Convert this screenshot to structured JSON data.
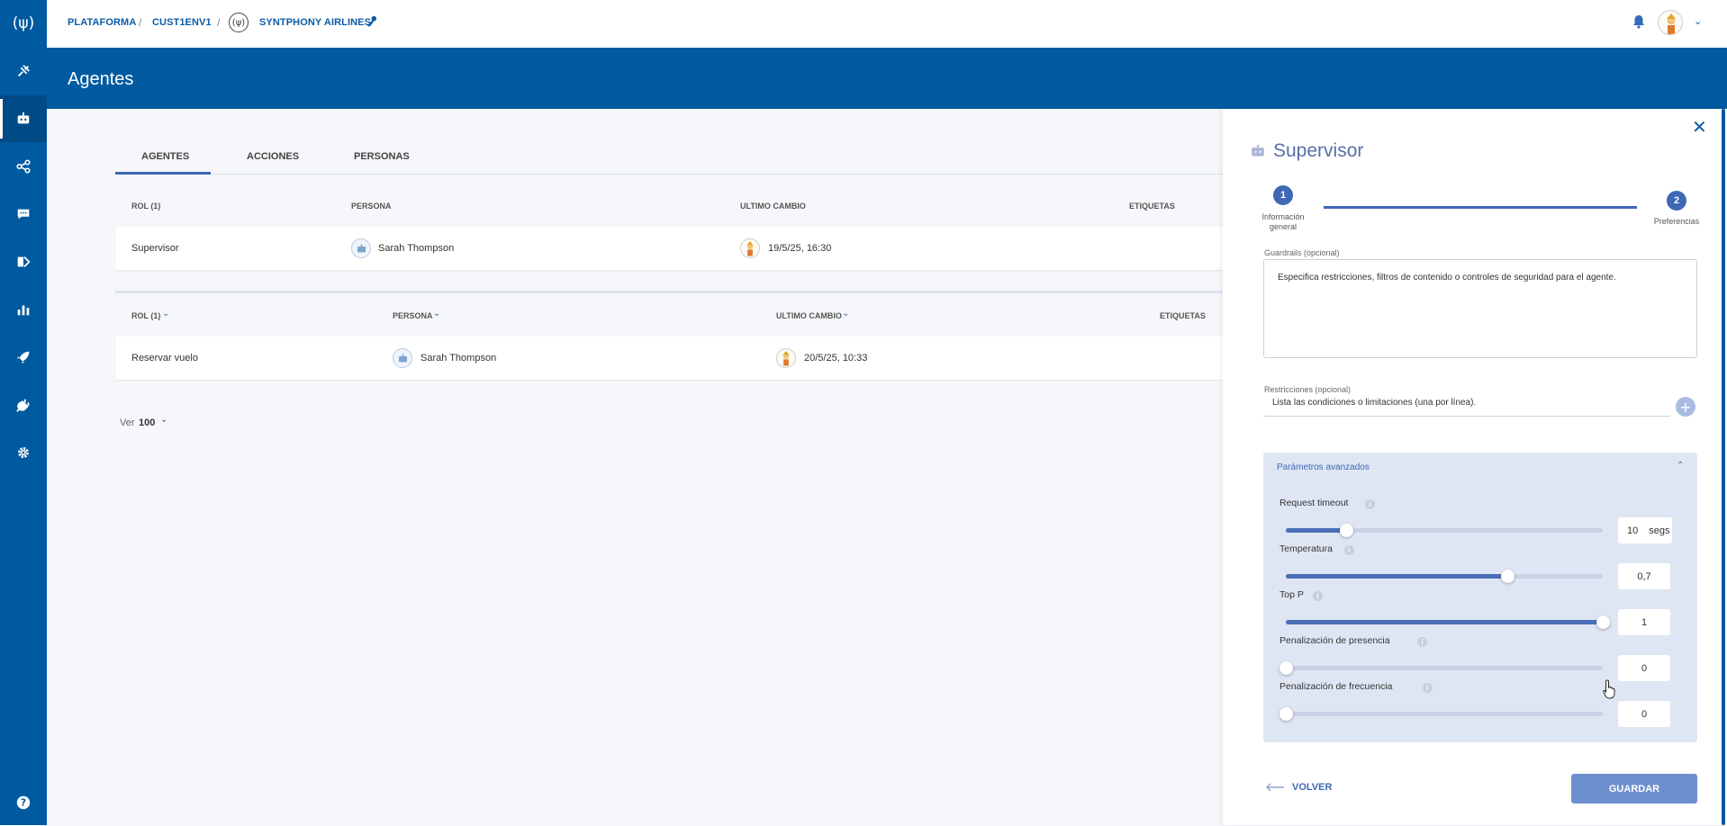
{
  "sidebar": {
    "logo_icon": "synthphony-logo-icon",
    "items": [
      "satellite-icon",
      "bot-icon",
      "flow-icon",
      "chat-icon",
      "integration-icon",
      "analytics-icon",
      "rocket-icon",
      "plug-icon",
      "gear-icon"
    ],
    "help_icon": "help-icon",
    "active_index": 1
  },
  "breadcrumb": {
    "item1": "PLATAFORMA",
    "item2": "CUST1ENV1",
    "item3": "SYNTPHONY AIRLINES",
    "sep": "/"
  },
  "page": {
    "title": "Agentes"
  },
  "tabs": [
    "AGENTES",
    "ACCIONES",
    "PERSONAS"
  ],
  "table1": {
    "headers": [
      "ROL (1)",
      "PERSONA",
      "ULTIMO CAMBIO",
      "ETIQUETAS"
    ],
    "row": {
      "rol": "Supervisor",
      "persona": "Sarah Thompson",
      "cambio": "19/5/25, 16:30"
    }
  },
  "table2": {
    "headers": [
      "ROL (1)",
      "PERSONA",
      "ULTIMO CAMBIO",
      "ETIQUETAS"
    ],
    "row": {
      "rol": "Reservar vuelo",
      "persona": "Sarah Thompson",
      "cambio": "20/5/25, 10:33"
    }
  },
  "pager": {
    "label": "Ver",
    "value": "100"
  },
  "panel": {
    "title": "Supervisor",
    "steps": [
      {
        "number": "1",
        "label_line1": "Información",
        "label_line2": "general"
      },
      {
        "number": "2",
        "label_line1": "Preferencias",
        "label_line2": ""
      }
    ],
    "guardrails_label": "Guardrails (opcional)",
    "guardrails_text": "Especifica restricciones, filtros de contenido o controles de seguridad para el agente.",
    "restricciones_label": "Restricciones (opcional)",
    "restricciones_placeholder": "Lista las condiciones o limitaciones (una por línea).",
    "advanced_title": "Parámetros avanzados",
    "params": [
      {
        "label": "Request timeout",
        "value": "10",
        "unit": "segs",
        "fraction": 0.19
      },
      {
        "label": "Temperatura",
        "value": "0,7",
        "unit": "",
        "fraction": 0.7
      },
      {
        "label": "Top P",
        "value": "1",
        "unit": "",
        "fraction": 1.0
      },
      {
        "label": "Penalización de presencia",
        "value": "0",
        "unit": "",
        "fraction": 0.0
      },
      {
        "label": "Penalización de frecuencia",
        "value": "0",
        "unit": "",
        "fraction": 0.0
      }
    ],
    "volver": "VOLVER",
    "guardar": "GUARDAR"
  },
  "colors": {
    "brand": "#005aa0",
    "accent": "#3d68b4",
    "button": "#6e8fcf"
  }
}
